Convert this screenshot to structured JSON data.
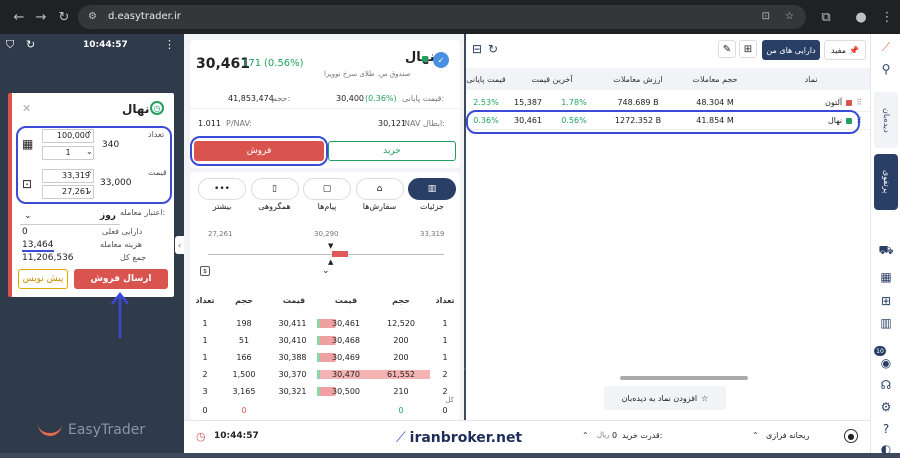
{
  "browser": {
    "url": "d.easytrader.ir"
  },
  "left": {
    "time": "10:44:57",
    "brand": "EasyTrader",
    "symbol_title": "نهال",
    "qty_label": "تعداد",
    "qty_step": "100,000",
    "qty_min": "1",
    "qty_value": "340",
    "price_label": "قیمت",
    "price_high": "33,319",
    "price_low": "27,261",
    "price_value": "33,000",
    "validity_label": "اعتبار معامله:",
    "validity_value": "روز",
    "asset_label": "دارایی فعلی",
    "asset_value": "0",
    "fee_label": "هزینه معامله",
    "fee_value": "13,464",
    "total_label": "جمع کل",
    "total_value": "11,206,536",
    "draft_btn": "پیش نویس",
    "send_btn": "ارسال فروش",
    "sell_color": "#d9534f"
  },
  "symbol": {
    "name": "نهال",
    "fund_name": "صندوق س. طلای سرخ نوویرا",
    "last_price": "30,461",
    "change": "171",
    "change_pct": "(0.56%)",
    "volume_label": "حجم:",
    "volume": "41,853,474",
    "close_label": "قیمت پایانی:",
    "close_price": "30,400",
    "close_pct": "(0.36%)",
    "pnav_label": "P/NAV:",
    "pnav": "1.011",
    "navcancel_label": "NAV ابطال:",
    "navcancel": "30,121",
    "sell_tab": "فروش",
    "buy_tab": "خرید",
    "up_color": "#22a060"
  },
  "tabs": [
    {
      "label": "جزئیات",
      "icon": "chart-icon"
    },
    {
      "label": "سفارش‌ها",
      "icon": "basket-icon"
    },
    {
      "label": "پیام‌ها",
      "icon": "chat-icon"
    },
    {
      "label": "همگروهی",
      "icon": "compare-icon"
    },
    {
      "label": "بیشتر",
      "icon": "more-icon"
    }
  ],
  "range": {
    "min": "27,261",
    "mid": "30,290",
    "max": "33,319"
  },
  "orderbook": {
    "headers": [
      "تعداد",
      "حجم",
      "قیمت",
      "قیمت",
      "حجم",
      "تعداد"
    ],
    "rows": [
      [
        "1",
        "198",
        "30,411",
        "30,461",
        "12,520",
        "1"
      ],
      [
        "1",
        "51",
        "30,410",
        "30,468",
        "200",
        "1"
      ],
      [
        "1",
        "166",
        "30,388",
        "30,469",
        "200",
        "1"
      ],
      [
        "2",
        "1,500",
        "30,370",
        "30,470",
        "61,552",
        "2"
      ],
      [
        "3",
        "3,165",
        "30,321",
        "30,500",
        "210",
        "2"
      ]
    ],
    "total_label": "کل",
    "totals": [
      "0",
      "0",
      "0",
      "0"
    ]
  },
  "watch": {
    "top_btn1": "مفید",
    "top_btn2": "دارایی های من",
    "headers": [
      "نماد",
      "حجم معاملات",
      "ارزش معاملات",
      "آخرین قیمت",
      "قیمت پایانی"
    ],
    "rows": [
      {
        "name": "آلتون",
        "volume": "48.304 M",
        "value": "748.689 B",
        "last_pct": "1.78%",
        "last": "15,387",
        "close_pct": "2.53%",
        "dot": "#d9534f"
      },
      {
        "name": "نهال",
        "volume": "41.854 M",
        "value": "1272.352 B",
        "last_pct": "0.56%",
        "last": "30,461",
        "close_pct": "0.36%",
        "dot": "#22a060"
      }
    ],
    "add_btn": "افزودن نماد به دیده‌بان"
  },
  "rail": {
    "tab1": "دیده‌بان",
    "tab2": "پرتفوی",
    "badge": "10"
  },
  "footer": {
    "user": "ریحانه فرازی",
    "buy_power_label": "قدرت خرید:",
    "buy_power": "0",
    "currency": "ریال",
    "time": "10:44:57",
    "watermark": "iranbroker.net"
  }
}
